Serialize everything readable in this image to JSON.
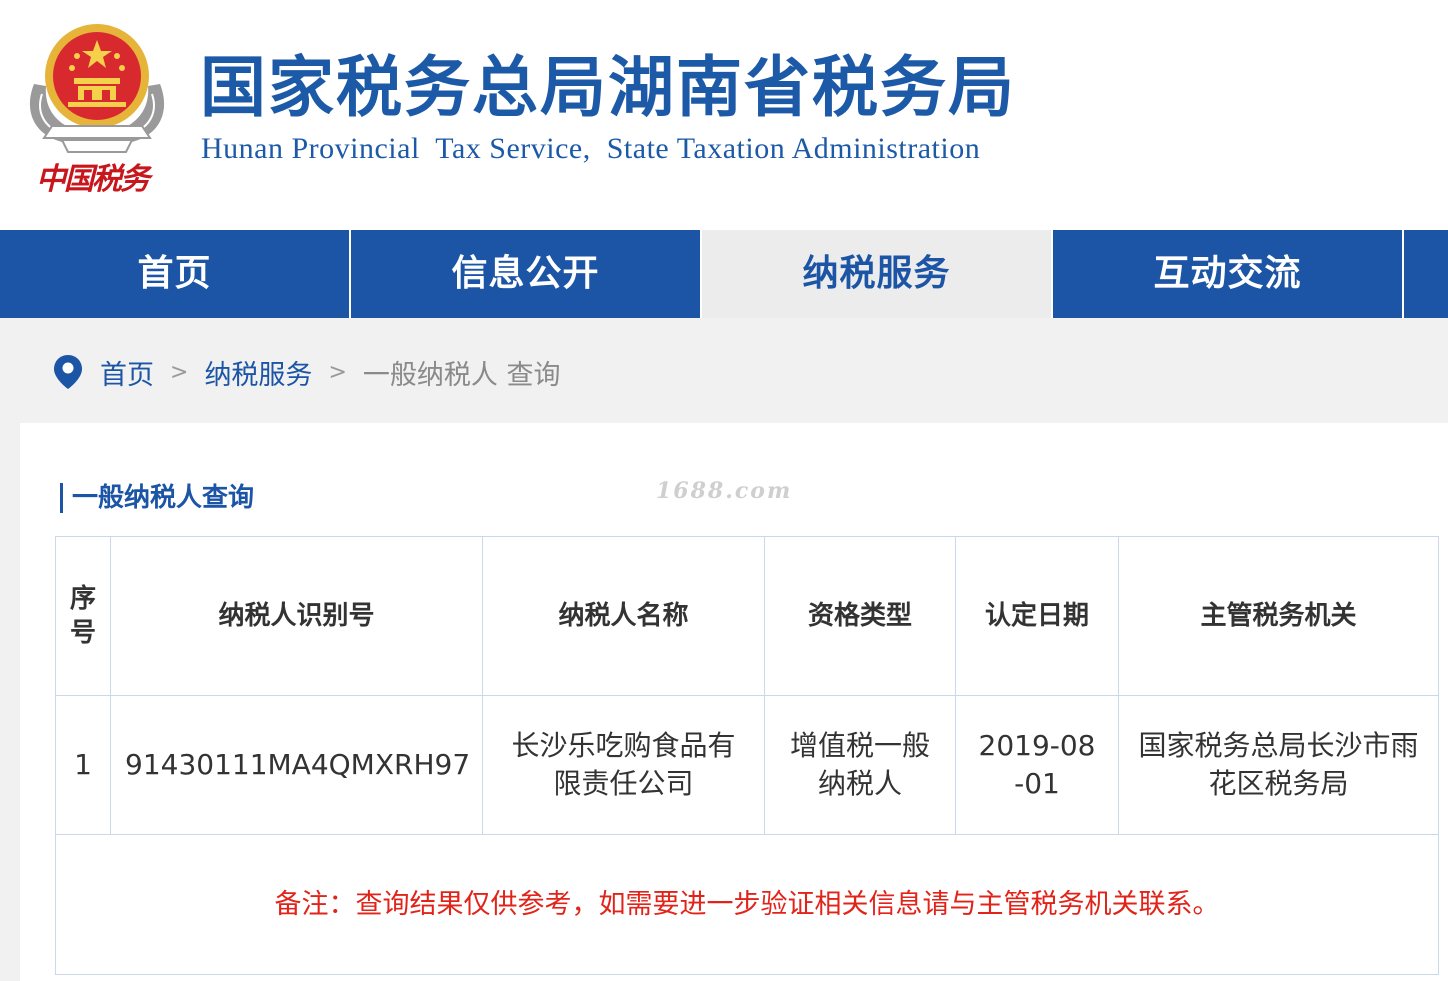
{
  "header": {
    "title_cn": "国家税务总局湖南省税务局",
    "title_en": "Hunan Provincial  Tax Service,  State Taxation Administration",
    "emblem_text": "中国税务",
    "brand_color": "#1c5aa8"
  },
  "nav": {
    "items": [
      {
        "label": "首页",
        "active": false
      },
      {
        "label": "信息公开",
        "active": false
      },
      {
        "label": "纳税服务",
        "active": true
      },
      {
        "label": "互动交流",
        "active": false
      }
    ],
    "bg_color": "#1c55a5",
    "active_bg_color": "#ececec"
  },
  "breadcrumb": {
    "icon": "location-pin-icon",
    "home": "首页",
    "section": "纳税服务",
    "current": "一般纳税人 查询",
    "separator": ">"
  },
  "main": {
    "section_title": "一般纳税人查询",
    "watermark": "1688.com",
    "table": {
      "headers": {
        "seq": "序号",
        "tax_id": "纳税人识别号",
        "name": "纳税人名称",
        "qualification": "资格类型",
        "date": "认定日期",
        "authority": "主管税务机关"
      },
      "rows": [
        {
          "seq": "1",
          "tax_id": "91430111MA4QMXRH97",
          "name": "长沙乐吃购食品有限责任公司",
          "qualification": "增值税一般纳税人",
          "date": "2019-08-01",
          "authority": "国家税务总局长沙市雨花区税务局"
        }
      ],
      "note": "备注：查询结果仅供参考，如需要进一步验证相关信息请与主管税务机关联系。",
      "note_color": "#e2231a",
      "border_color": "#c9d9ea"
    }
  }
}
